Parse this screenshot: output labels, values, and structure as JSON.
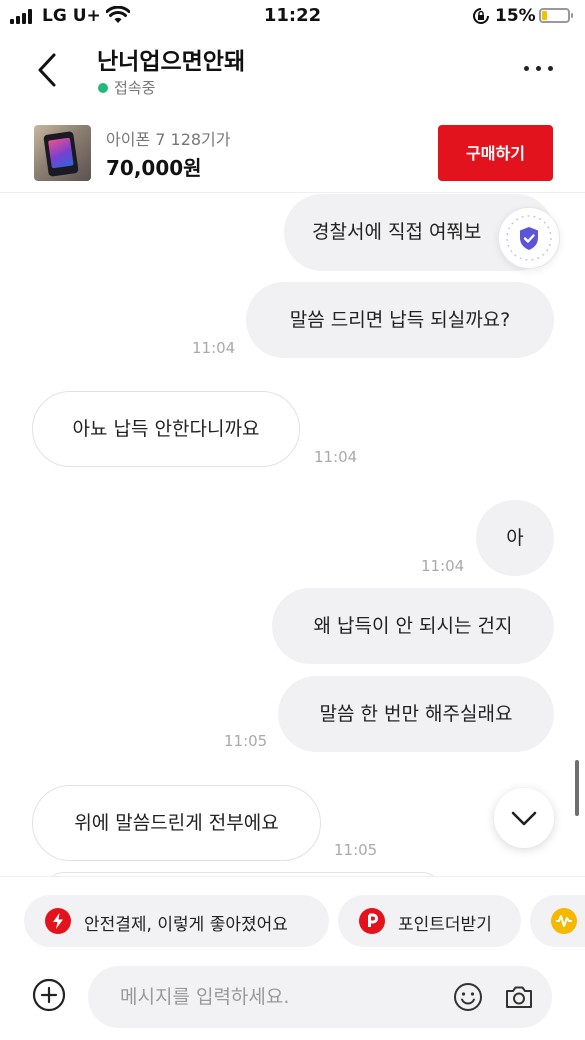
{
  "status_bar": {
    "carrier": "LG U+",
    "time": "11:22",
    "battery": "15%",
    "icons": [
      "signal-icon",
      "wifi-icon",
      "orientation-lock-icon",
      "battery-icon"
    ]
  },
  "header": {
    "title": "난너업으면안돼",
    "status": "접속중",
    "status_color": "#1fb97a",
    "icons": [
      "back-icon",
      "more-icon"
    ]
  },
  "product": {
    "name": "아이폰 7 128기가",
    "price": "70,000원",
    "buy_label": "구매하기",
    "buy_color": "#e3131d"
  },
  "messages": [
    {
      "side": "me",
      "text": "경찰서에 직접 여쭤보",
      "time": ""
    },
    {
      "side": "me",
      "text": "말씀 드리면 납득 되실까요?",
      "time": "11:04"
    },
    {
      "side": "them",
      "text": "아뇨 납득 안한다니까요",
      "time": "11:04"
    },
    {
      "side": "me",
      "text": "아",
      "time": "11:04"
    },
    {
      "side": "me",
      "text": "왜 납득이 안 되시는 건지",
      "time": ""
    },
    {
      "side": "me",
      "text": "말씀 한 번만 해주실래요",
      "time": "11:05"
    },
    {
      "side": "them",
      "text": "위에 말씀드린게 전부에요",
      "time": "11:05"
    }
  ],
  "quick_chips": [
    {
      "label": "안전결제, 이렇게 좋아졌어요",
      "icon": "lightning-icon"
    },
    {
      "label": "포인트더받기",
      "icon": "point-icon"
    },
    {
      "label": "",
      "icon": "pay-icon"
    }
  ],
  "composer": {
    "placeholder": "메시지를 입력하세요.",
    "icons": [
      "plus-icon",
      "emoji-icon",
      "camera-icon"
    ]
  }
}
